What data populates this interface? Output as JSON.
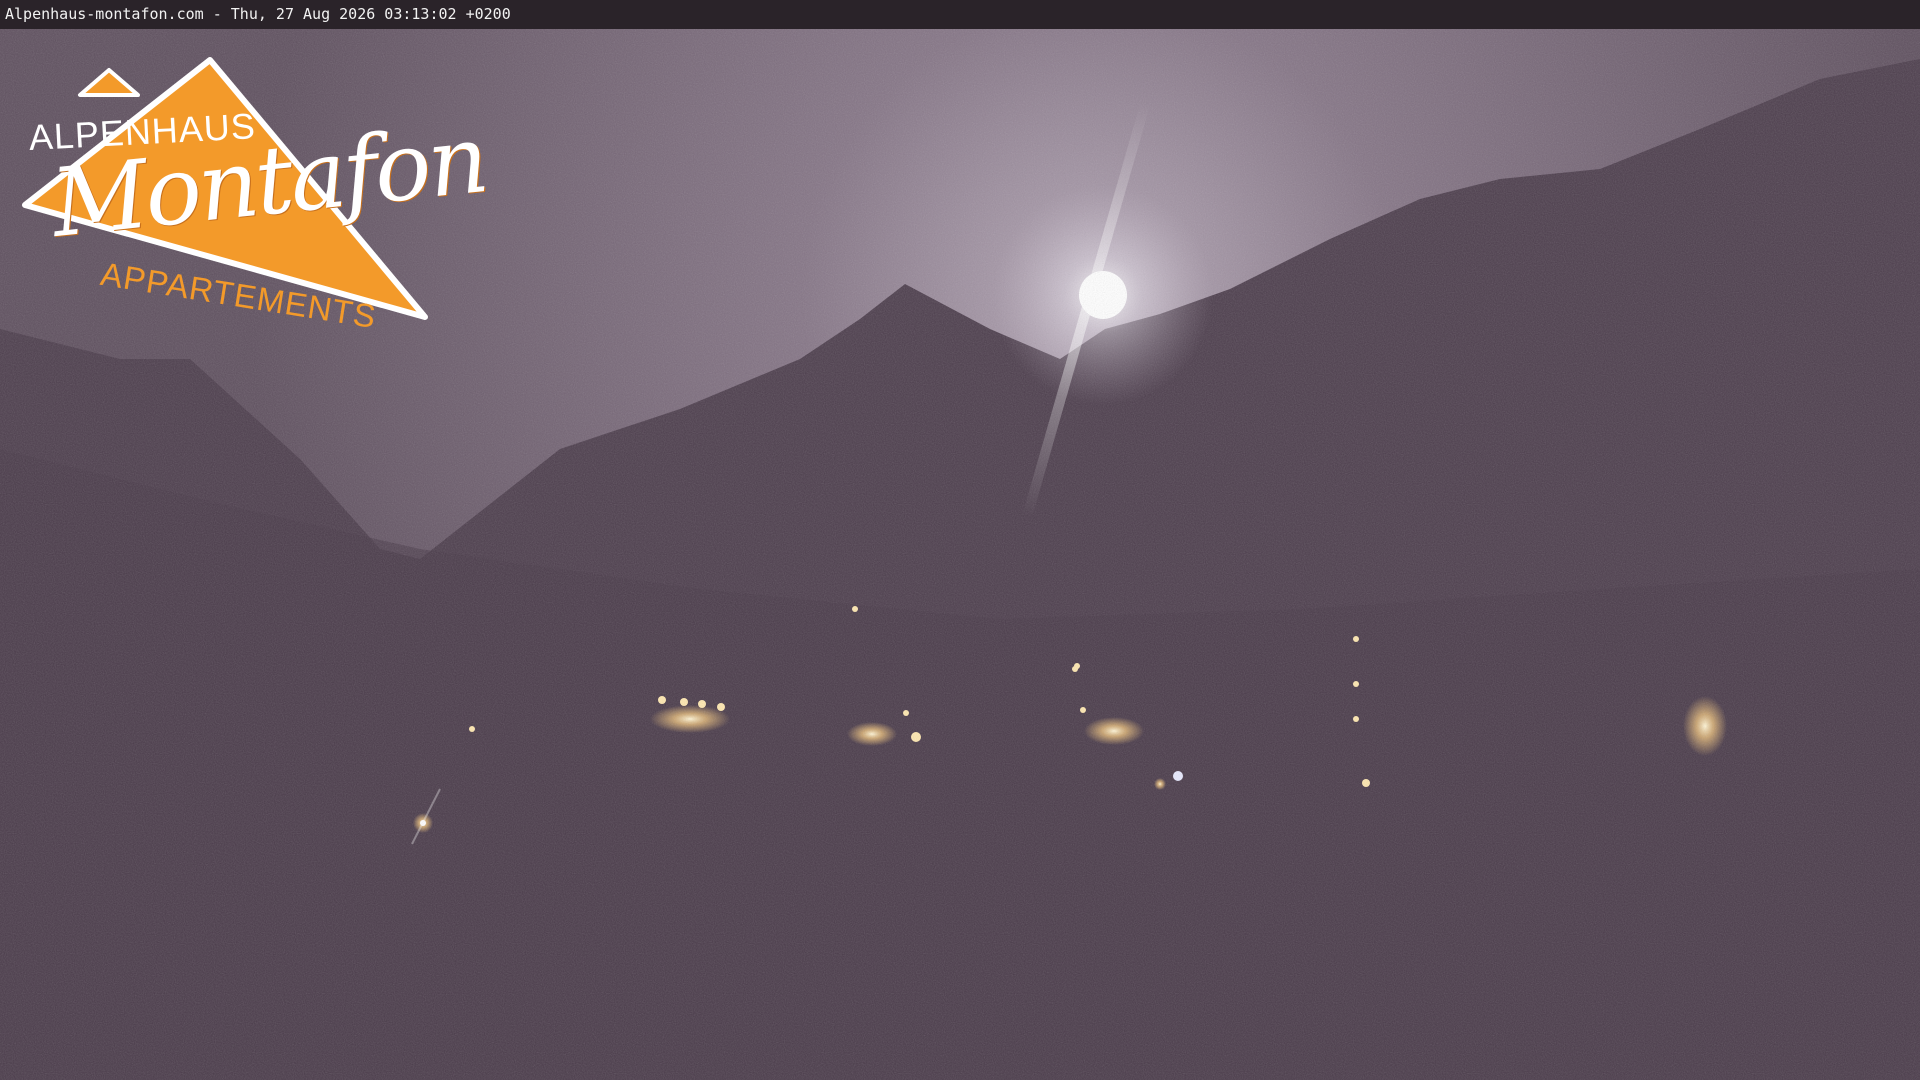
{
  "overlay": {
    "timestamp": "Alpenhaus-montafon.com - Thu, 27 Aug 2026 03:13:02 +0200"
  },
  "logo": {
    "line1": "ALPENHAUS",
    "line2": "Montafon",
    "line3": "APPARTEMENTS",
    "color": "#f39a2a"
  },
  "scene": {
    "sky_color": "#6a5b6a",
    "mountain_color": "#4a3b4a",
    "moon_color": "#ffffff",
    "town_light_color": "#ffcf80"
  }
}
